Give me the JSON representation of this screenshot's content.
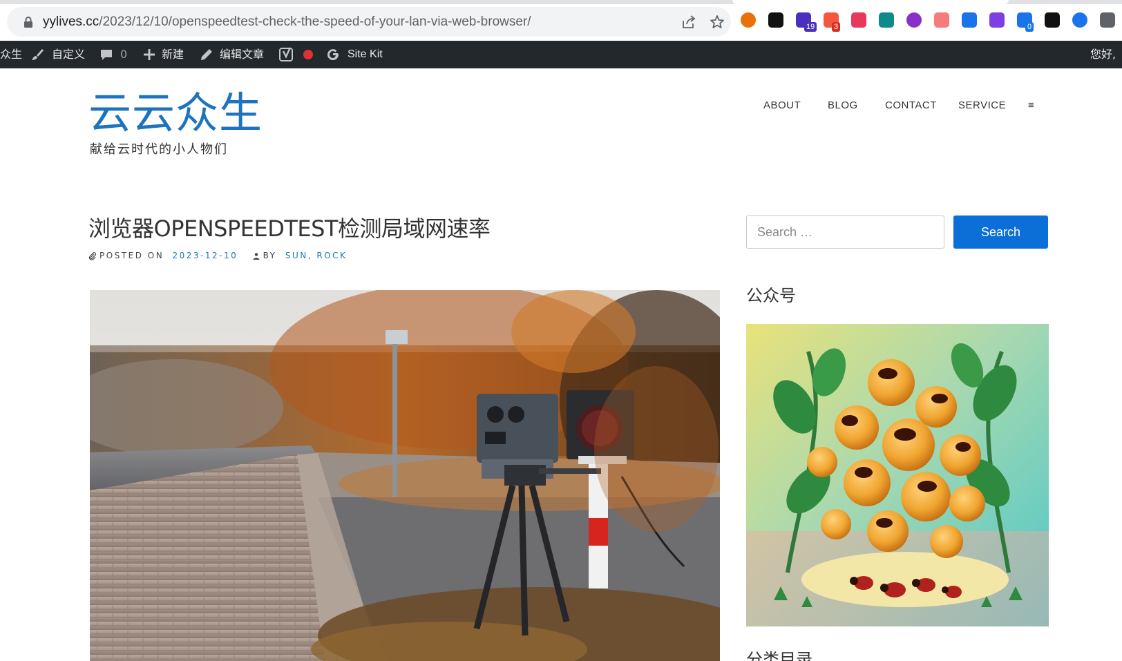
{
  "browser": {
    "url_host": "yylives.cc",
    "url_path": "/2023/12/10/openspeedtest-check-the-speed-of-your-lan-via-web-browser/",
    "extensions": [
      {
        "name": "extension-orange-circle-icon",
        "color": "#e8710a"
      },
      {
        "name": "extension-notion-icon",
        "color": "#111111"
      },
      {
        "name": "extension-graduation-cap-icon",
        "color": "#4a2fbd",
        "badge": "19",
        "badge_color": "#4a2fbd"
      },
      {
        "name": "extension-red-dots-icon",
        "color": "#f2583e",
        "badge": "3",
        "badge_color": "#d93025"
      },
      {
        "name": "extension-translate-icon",
        "color": "#e8385c"
      },
      {
        "name": "extension-teal-grid-icon",
        "color": "#0f8a8a"
      },
      {
        "name": "extension-purple-circle-icon",
        "color": "#8b2fc9"
      },
      {
        "name": "extension-cloud-icon",
        "color": "#f47c7c"
      },
      {
        "name": "extension-blue-flag-icon",
        "color": "#1a73e8"
      },
      {
        "name": "extension-openai-icon",
        "color": "#7b3fe4"
      },
      {
        "name": "extension-sync-icon",
        "color": "#1a73e8",
        "badge": "0",
        "badge_color": "#1a73e8"
      },
      {
        "name": "extension-black-square-icon",
        "color": "#111111"
      },
      {
        "name": "extension-blue-circle-icon",
        "color": "#1a73e8"
      },
      {
        "name": "extensions-puzzle-icon",
        "color": "#5f6368"
      }
    ]
  },
  "adminbar": {
    "site_name_fragment": "众生",
    "customize": "自定义",
    "comments_count": "0",
    "new": "新建",
    "edit_post": "编辑文章",
    "sitekit": "Site Kit",
    "greeting": "您好,"
  },
  "header": {
    "site_title": "云云众生",
    "site_description": "献给云时代的小人物们",
    "menu": [
      "ABOUT",
      "BLOG",
      "CONTACT",
      "SERVICE",
      "≡"
    ]
  },
  "post": {
    "title": "浏览器OPENSPEEDTEST检测局域网速率",
    "posted_on_label": "POSTED ON",
    "date": "2023-12-10",
    "by_label": "BY",
    "authors": "SUN, ROCK"
  },
  "sidebar": {
    "search_placeholder": "Search …",
    "search_button": "Search",
    "widget1_title": "公众号",
    "widget2_title": "分类目录"
  },
  "colors": {
    "accent": "#1e73be",
    "adminbar_bg": "#23282d"
  }
}
